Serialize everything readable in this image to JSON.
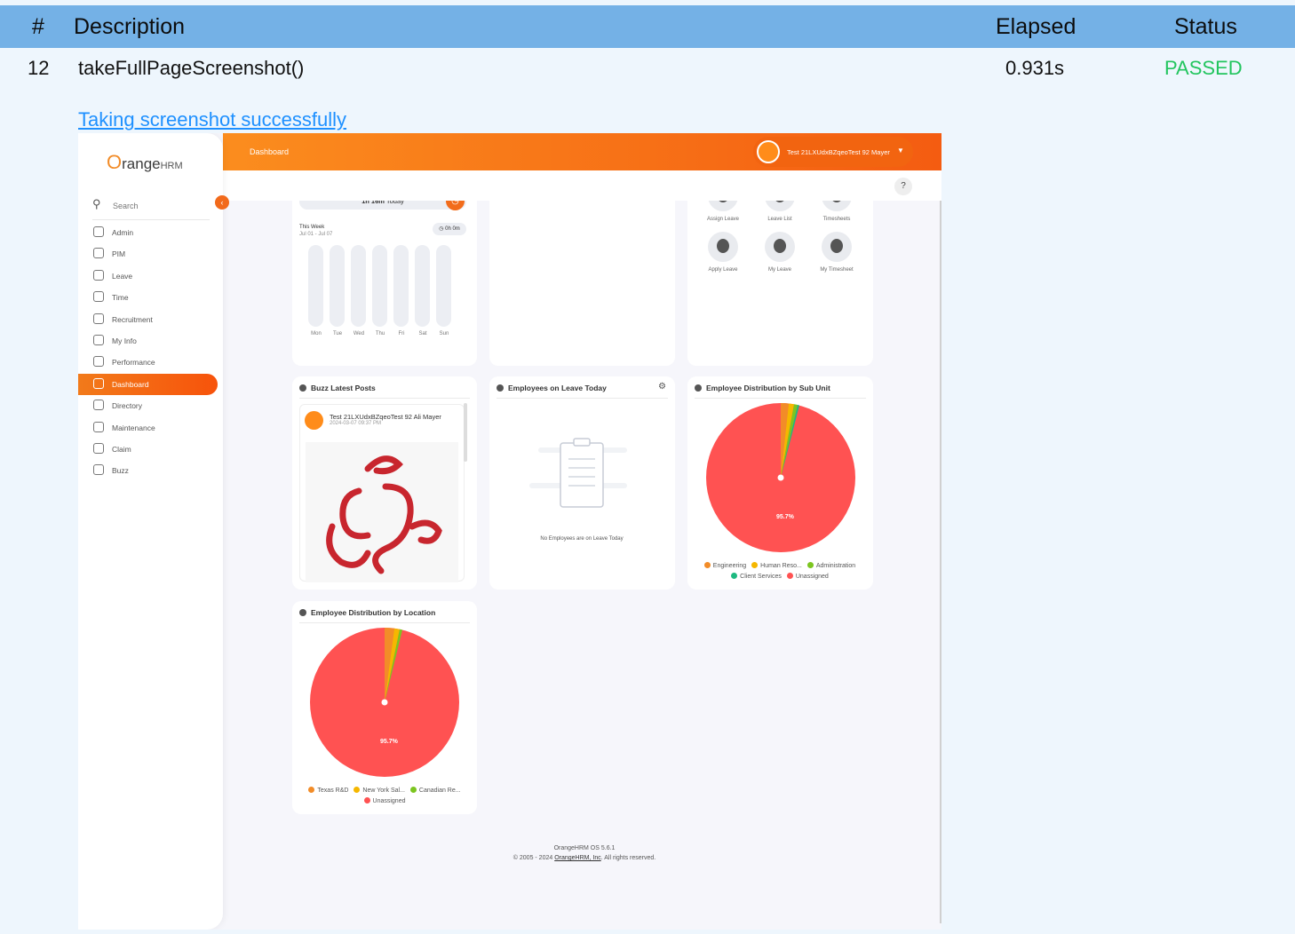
{
  "report": {
    "headers": [
      "#",
      "Description",
      "Elapsed",
      "Status"
    ],
    "row": {
      "index": "12",
      "description": "takeFullPageScreenshot()",
      "elapsed": "0.931s",
      "status": "PASSED"
    },
    "link": "Taking screenshot successfully"
  },
  "app": {
    "logo_main": "range",
    "logo_o": "O",
    "logo_hrm": "HRM",
    "page_title": "Dashboard",
    "user_name": "Test 21LXUdxBZqeoTest 92 Mayer",
    "search_label": "Search",
    "help": "?",
    "nav": [
      "Admin",
      "PIM",
      "Leave",
      "Time",
      "Recruitment",
      "My Info",
      "Performance",
      "Dashboard",
      "Directory",
      "Maintenance",
      "Claim",
      "Buzz"
    ],
    "active_nav": "Dashboard"
  },
  "time_card": {
    "today": "1h 16m",
    "today_suffix": "Today",
    "week_label": "This Week",
    "week_range": "Jul 01 - Jul 07",
    "week_total": "0h 0m",
    "days": [
      "Mon",
      "Tue",
      "Wed",
      "Thu",
      "Fri",
      "Sat",
      "Sun"
    ]
  },
  "quick_actions": [
    "Assign Leave",
    "Leave List",
    "Timesheets",
    "Apply Leave",
    "My Leave",
    "My Timesheet"
  ],
  "buzz": {
    "title": "Buzz Latest Posts",
    "author": "Test 21LXUdxBZqeoTest 92 Ali Mayer",
    "date": "2024-03-07 09:37 PM"
  },
  "leave_today": {
    "title": "Employees on Leave Today",
    "empty": "No Employees are on Leave Today"
  },
  "subunit_chart": {
    "title": "Employee Distribution by Sub Unit",
    "label": "95.7%",
    "legend": [
      {
        "name": "Engineering",
        "color": "#f28c28"
      },
      {
        "name": "Human Reso...",
        "color": "#f5b700"
      },
      {
        "name": "Administration",
        "color": "#7cc520"
      },
      {
        "name": "Client Services",
        "color": "#1eb980"
      },
      {
        "name": "Unassigned",
        "color": "#ff5252"
      }
    ]
  },
  "location_chart": {
    "title": "Employee Distribution by Location",
    "label": "95.7%",
    "legend": [
      {
        "name": "Texas R&D",
        "color": "#f28c28"
      },
      {
        "name": "New York Sal...",
        "color": "#f5b700"
      },
      {
        "name": "Canadian Re...",
        "color": "#7cc520"
      },
      {
        "name": "Unassigned",
        "color": "#ff5252"
      }
    ]
  },
  "footer": {
    "version": "OrangeHRM OS 5.6.1",
    "copy_pre": "© 2005 - 2024",
    "copy_link": "OrangeHRM, Inc",
    "copy_post": ". All rights reserved."
  }
}
